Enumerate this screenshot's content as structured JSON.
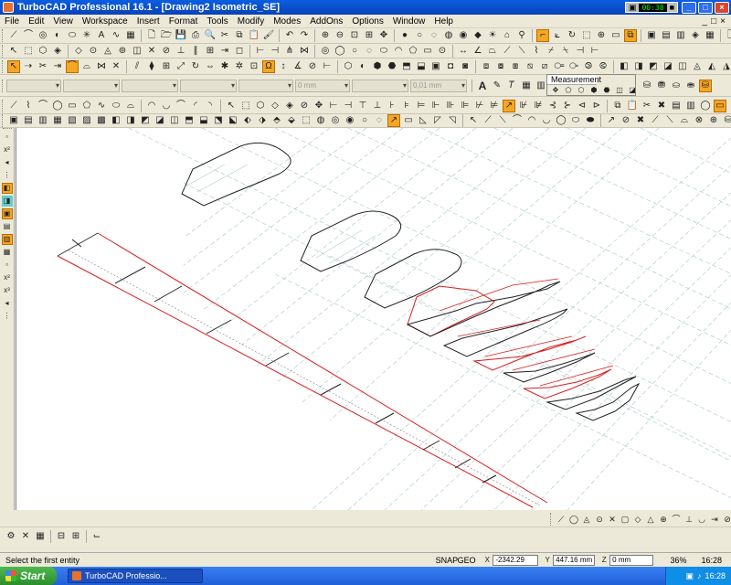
{
  "window": {
    "title": "TurboCAD Professional 16.1 - [Drawing2 Isometric_SE]",
    "tray_time": "00:38",
    "minimize": "_",
    "maximize": "□",
    "close": "×"
  },
  "menu": {
    "items": [
      "File",
      "Edit",
      "View",
      "Workspace",
      "Insert",
      "Format",
      "Tools",
      "Modify",
      "Modes",
      "AddOns",
      "Options",
      "Window",
      "Help"
    ],
    "mdi_controls": [
      "_",
      "□",
      "×"
    ]
  },
  "properties": {
    "combo_1": "",
    "combo_2": "",
    "combo_3": "",
    "combo_4": "",
    "combo_5": "",
    "length_value": "0 mm",
    "combo_7": "",
    "thickness_value": "0,01 mm"
  },
  "measurement_panel": {
    "caption": "Measurement"
  },
  "statusbar": {
    "message": "Select the first entity",
    "snap": "SNAP",
    "geo": "GEO",
    "x_coord": "-2342.29 mm",
    "y_coord": "447.16 mm",
    "z_coord": "0 mm",
    "zoom": "36%",
    "time": "16:28"
  },
  "taskbar": {
    "start_label": "Start",
    "task_label": "TurboCAD Professio...",
    "clock": "16:28"
  },
  "colors": {
    "titlebar": "#0a5ee0",
    "highlight_icon": "#f5a623",
    "red_geometry": "#d42020",
    "grid_line": "#a9c6c9"
  }
}
